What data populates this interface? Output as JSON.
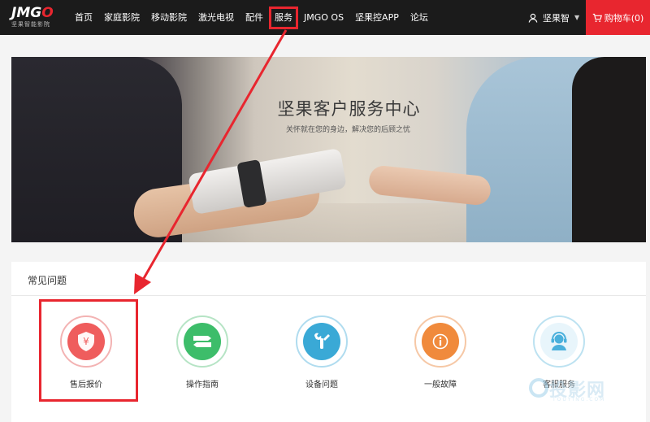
{
  "brand": {
    "logo_main": "JMG",
    "logo_accent": "O",
    "logo_sub": "坚果智能影院"
  },
  "nav": {
    "items": [
      {
        "label": "首页"
      },
      {
        "label": "家庭影院"
      },
      {
        "label": "移动影院"
      },
      {
        "label": "激光电视"
      },
      {
        "label": "配件"
      },
      {
        "label": "服务",
        "active": true
      },
      {
        "label": "JMGO OS"
      },
      {
        "label": "坚果控APP"
      },
      {
        "label": "论坛"
      }
    ]
  },
  "user": {
    "name": "坚果智",
    "icon": "user-icon"
  },
  "cart": {
    "label": "购物车(0)",
    "icon": "cart-icon"
  },
  "banner": {
    "title": "坚果客户服务中心",
    "subtitle": "关怀就在您的身边，解决您的后顾之忧"
  },
  "faq": {
    "title": "常见问题",
    "items": [
      {
        "label": "售后报价",
        "icon": "shield-yen-icon",
        "color": "#ef5d5d"
      },
      {
        "label": "操作指南",
        "icon": "guide-icon",
        "color": "#3dbd6a"
      },
      {
        "label": "设备问题",
        "icon": "wrench-icon",
        "color": "#3aa9d6"
      },
      {
        "label": "一般故障",
        "icon": "info-icon",
        "color": "#f08a3c"
      },
      {
        "label": "客服服务",
        "icon": "headset-icon",
        "color": "#4ab0dc"
      }
    ]
  },
  "watermark": {
    "text": "投影网",
    "sub": "TOUYING.COM"
  },
  "colors": {
    "accent": "#e8262f",
    "nav_bg": "#1b1b1b"
  }
}
